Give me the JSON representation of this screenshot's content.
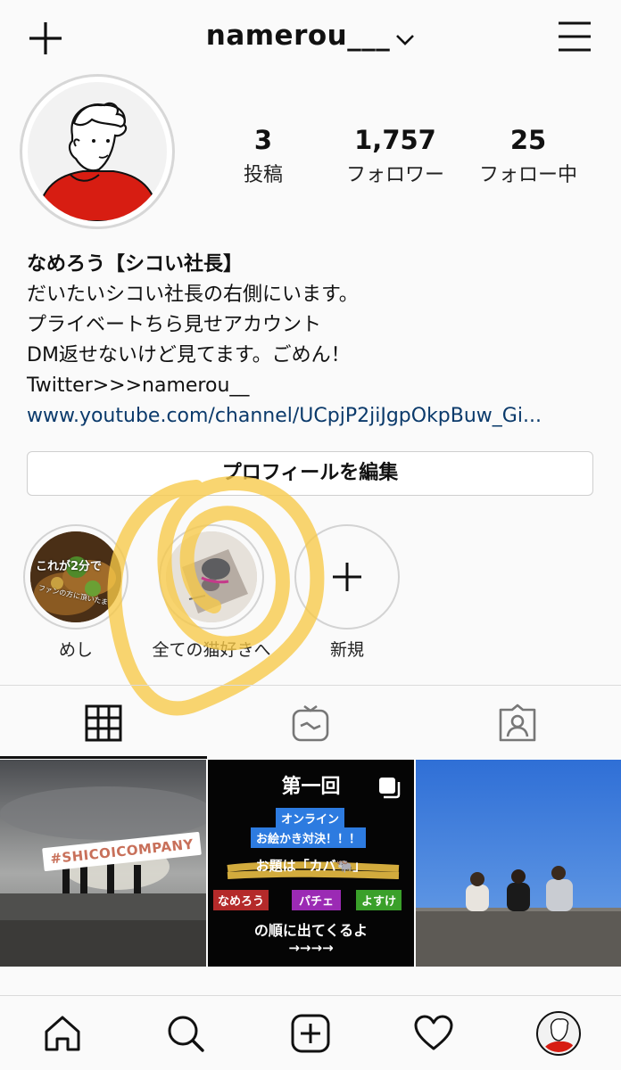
{
  "header": {
    "username": "namerou___",
    "new_icon": "plus-icon",
    "menu_icon": "hamburger-menu-icon"
  },
  "profile": {
    "stats": [
      {
        "value": "3",
        "label": "投稿"
      },
      {
        "value": "1,757",
        "label": "フォロワー"
      },
      {
        "value": "25",
        "label": "フォロー中"
      }
    ],
    "display_name": "なめろう【シコい社長】",
    "bio_lines": [
      "だいたいシコい社長の右側にいます。",
      "プライベートちら見せアカウント",
      "DM返せないけど見てます。ごめん！",
      "Twitter>>>namerou__"
    ],
    "link": "www.youtube.com/channel/UCpjP2jiJgpOkpBuw_Gi..."
  },
  "edit_profile_label": "プロフィールを編集",
  "highlights": [
    {
      "label": "めし",
      "overlay_top": "これが2分で",
      "overlay_bottom": "ファンの方に頂いたま"
    },
    {
      "label": "全ての猫好きへ"
    },
    {
      "label": "新規"
    }
  ],
  "tabs": [
    "grid-icon",
    "igtv-icon",
    "tagged-icon"
  ],
  "posts": [
    {
      "sticker": "#SHICOICOMPANY"
    },
    {
      "title": "第一回",
      "tag1": "オンライン",
      "tag2": "お絵かき対決！！！",
      "theme": "お題は「カバ🐃」",
      "names": [
        "なめろう",
        "パチェ",
        "よすけ"
      ],
      "order": "の順に出てくるよ",
      "arrows": "→→→→"
    },
    {}
  ],
  "bottom_nav": [
    "home-icon",
    "search-icon",
    "new-post-icon",
    "heart-icon",
    "profile-avatar"
  ],
  "colors": {
    "link": "#0b3a6b",
    "highlight_marker": "#f7c948"
  }
}
